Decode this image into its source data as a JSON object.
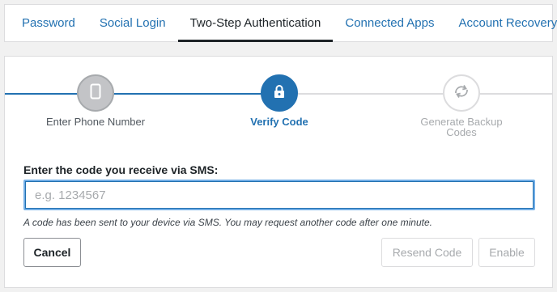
{
  "tabs": [
    {
      "label": "Password",
      "active": false
    },
    {
      "label": "Social Login",
      "active": false
    },
    {
      "label": "Two-Step Authentication",
      "active": true
    },
    {
      "label": "Connected Apps",
      "active": false
    },
    {
      "label": "Account Recovery",
      "active": false
    }
  ],
  "steps": [
    {
      "label": "Enter Phone Number",
      "icon": "phone-icon",
      "state": "completed"
    },
    {
      "label": "Verify Code",
      "icon": "lock-icon",
      "state": "active"
    },
    {
      "label": "Generate Backup Codes",
      "icon": "refresh-icon",
      "state": "pending"
    }
  ],
  "form": {
    "label": "Enter the code you receive via SMS:",
    "placeholder": "e.g. 1234567",
    "value": "",
    "hint": "A code has been sent to your device via SMS. You may request another code after one minute."
  },
  "buttons": {
    "cancel": "Cancel",
    "resend": "Resend Code",
    "enable": "Enable"
  },
  "colors": {
    "accent": "#2271b1",
    "completed_step": "#c3c4c7",
    "pending_border": "#dcdcde"
  }
}
